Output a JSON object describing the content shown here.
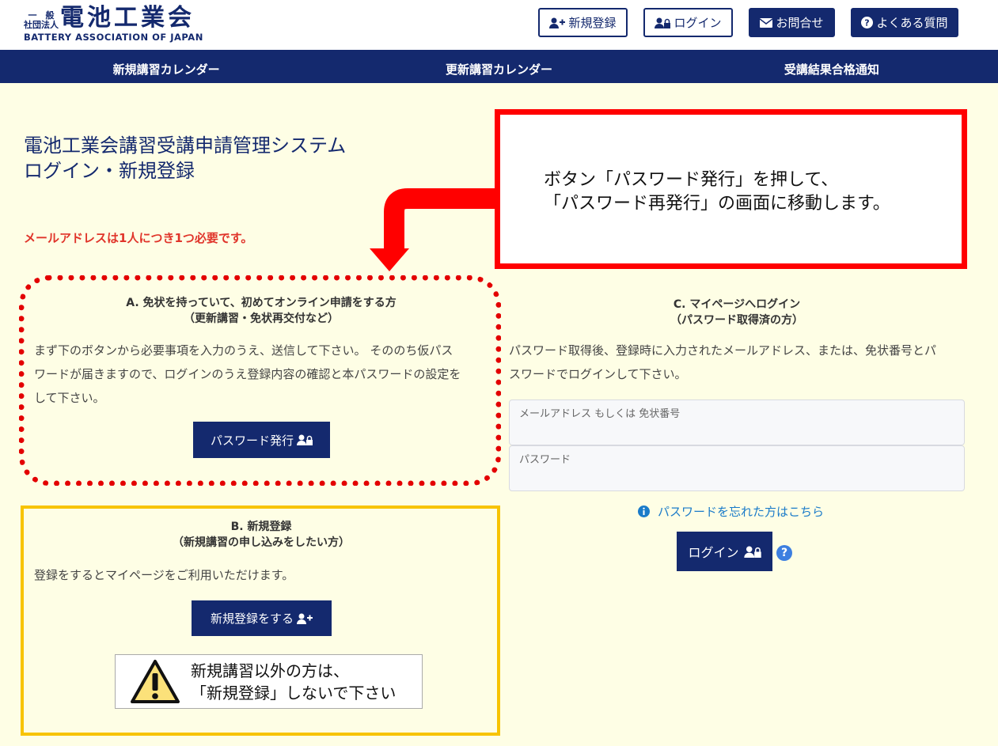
{
  "logo": {
    "small_line1": "一　般",
    "small_line2": "社団法人",
    "main": "電池工業会",
    "english": "BATTERY ASSOCIATION OF JAPAN"
  },
  "header_buttons": {
    "register": "新規登録",
    "login": "ログイン",
    "contact": "お問合せ",
    "faq": "よくある質問"
  },
  "nav": [
    "新規講習カレンダー",
    "更新講習カレンダー",
    "受講結果合格通知"
  ],
  "page_title": {
    "line1": "電池工業会講習受講申請管理システム",
    "line2": "ログイン・新規登録"
  },
  "email_notice": "メールアドレスは1人につき1つ必要です。",
  "callout": {
    "line1": "ボタン「パスワード発行」を押して、",
    "line2": "「パスワード再発行」の画面に移動します。"
  },
  "section_a": {
    "title1": "A. 免状を持っていて、初めてオンライン申請をする方",
    "title2": "（更新講習・免状再交付など）",
    "desc_line1": "まず下のボタンから必要事項を入力のうえ、送信して下さい。 そののち仮パス",
    "desc_line2": "ワードが届きますので、ログインのうえ登録内容の確認と本パスワードの設定を",
    "desc_line3": "して下さい。",
    "button": "パスワード発行"
  },
  "section_b": {
    "title1": "B. 新規登録",
    "title2": "（新規講習の申し込みをしたい方）",
    "desc": "登録をするとマイページをご利用いただけます。",
    "button": "新規登録をする",
    "warning_line1": "新規講習以外の方は、",
    "warning_line2": "「新規登録」しないで下さい"
  },
  "section_c": {
    "title1": "C. マイページへログイン",
    "title2": "（パスワード取得済の方）",
    "desc_line1": "パスワード取得後、登録時に入力されたメールアドレス、または、免状番号とパ",
    "desc_line2": "スワードでログインして下さい。",
    "email_label": "メールアドレス もしくは 免状番号",
    "password_label": "パスワード",
    "forgot": "パスワードを忘れた方はこちら",
    "login_button": "ログイン",
    "help": "?"
  },
  "colors": {
    "navy": "#14296e",
    "page_bg": "#fefee5",
    "red": "#ff0000",
    "notice_red": "#e0342a",
    "yellow_border": "#f7c300",
    "link_blue": "#1a7bc9"
  }
}
